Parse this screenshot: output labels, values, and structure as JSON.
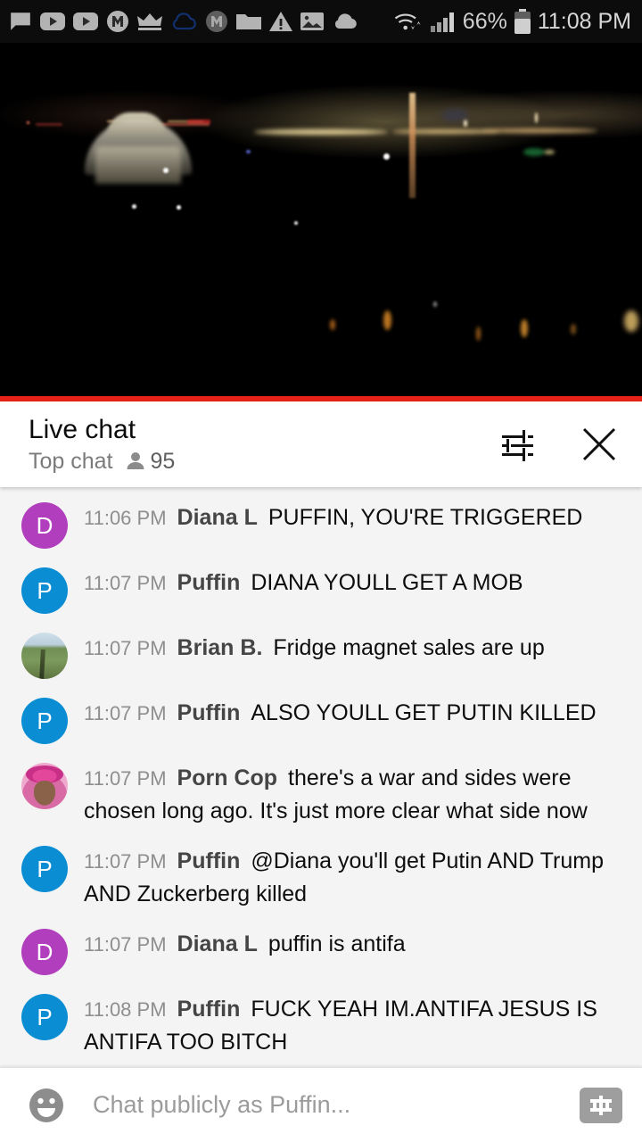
{
  "status_bar": {
    "icons": [
      {
        "name": "message-icon"
      },
      {
        "name": "youtube-icon"
      },
      {
        "name": "youtube-icon"
      },
      {
        "name": "m-badge-icon"
      },
      {
        "name": "crown-icon"
      },
      {
        "name": "cloud-outline-icon"
      },
      {
        "name": "m-circle-icon"
      },
      {
        "name": "folder-icon"
      },
      {
        "name": "warning-triangle-icon"
      },
      {
        "name": "image-icon"
      },
      {
        "name": "cloud-filled-icon"
      }
    ],
    "wifi_icon": "wifi-icon",
    "signal_icon": "cell-signal-icon",
    "battery_percent": "66%",
    "battery_icon": "battery-icon",
    "clock": "11:08 PM"
  },
  "video": {
    "name": "live-video-player",
    "description": "night cityscape",
    "progress_color": "#e62117",
    "progress_percent": 100
  },
  "chat_header": {
    "title": "Live chat",
    "subtitle": "Top chat",
    "viewer_icon": "person-icon",
    "viewer_count": "95",
    "settings_icon": "tune-sliders-icon",
    "close_icon": "close-icon"
  },
  "messages": [
    {
      "time": "11:06 PM",
      "author": "Diana L",
      "text": "PUFFIN, YOU'RE TRIGGERED",
      "avatar": {
        "type": "letter",
        "letter": "D",
        "color": "#b13fbd"
      }
    },
    {
      "time": "11:07 PM",
      "author": "Puffin",
      "text": "DIANA YOULL GET A MOB",
      "avatar": {
        "type": "letter",
        "letter": "P",
        "color": "#0b8dd4"
      }
    },
    {
      "time": "11:07 PM",
      "author": "Brian B.",
      "text": "Fridge magnet sales are up",
      "avatar": {
        "type": "photo",
        "style": "photo-brian"
      }
    },
    {
      "time": "11:07 PM",
      "author": "Puffin",
      "text": "ALSO YOULL GET PUTIN KILLED",
      "avatar": {
        "type": "letter",
        "letter": "P",
        "color": "#0b8dd4"
      }
    },
    {
      "time": "11:07 PM",
      "author": "Porn Cop",
      "text": "there's a war and sides were chosen long ago. It's just more clear what side now",
      "avatar": {
        "type": "photo",
        "style": "photo-porncop"
      }
    },
    {
      "time": "11:07 PM",
      "author": "Puffin",
      "text": "@Diana you'll get Putin AND Trump AND Zuckerberg killed",
      "avatar": {
        "type": "letter",
        "letter": "P",
        "color": "#0b8dd4"
      }
    },
    {
      "time": "11:07 PM",
      "author": "Diana L",
      "text": "puffin is antifa",
      "avatar": {
        "type": "letter",
        "letter": "D",
        "color": "#b13fbd"
      }
    },
    {
      "time": "11:08 PM",
      "author": "Puffin",
      "text": "FUCK YEAH IM.ANTIFA JESUS IS ANTIFA TOO BITCH",
      "avatar": {
        "type": "letter",
        "letter": "P",
        "color": "#0b8dd4"
      }
    }
  ],
  "composer": {
    "emoji_icon": "emoji-smiley-icon",
    "placeholder": "Chat publicly as Puffin...",
    "value": "",
    "superchat_icon": "dollar-bill-icon"
  }
}
